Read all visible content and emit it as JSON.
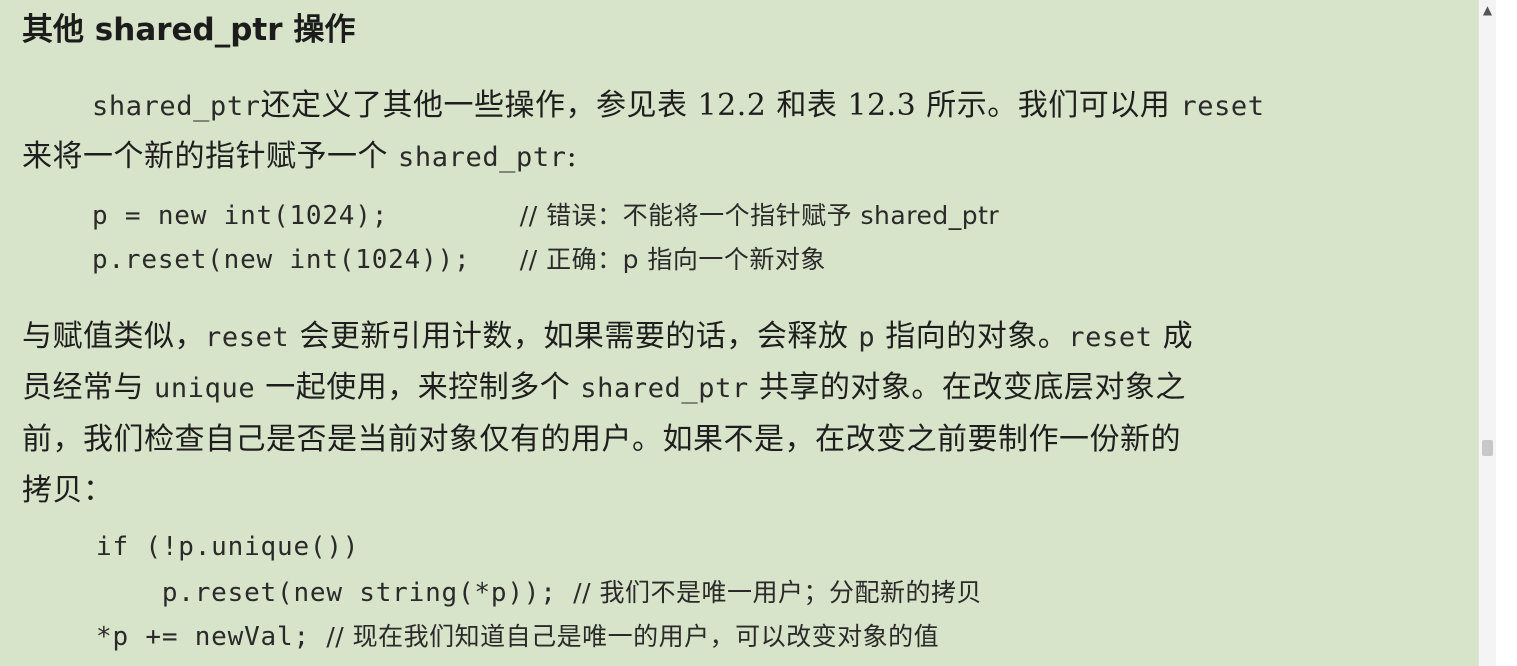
{
  "heading": "其他 shared_ptr 操作",
  "para1": {
    "line1": {
      "code_a": "shared_ptr",
      "text_a": "还定义了其他一些操作，参见表 12.2 和表 12.3 所示。我们可以用",
      "code_b": "reset"
    },
    "line2": {
      "text_a": "来将一个新的指针赋予一个",
      "code_a": "shared_ptr",
      "text_b": ":"
    }
  },
  "code1": [
    {
      "code": "p = new int(1024);        ",
      "comment": "// 错误：不能将一个指针赋予 shared_ptr"
    },
    {
      "code": "p.reset(new int(1024));   ",
      "comment": "// 正确：p 指向一个新对象"
    }
  ],
  "para2": {
    "line1": {
      "text_a": "与赋值类似，",
      "code_a": "reset",
      "text_b": "会更新引用计数，如果需要的话，会释放",
      "code_b": "p",
      "text_c": "指向的对象。",
      "code_c": "reset",
      "text_d": "成"
    },
    "line2": {
      "text_a": "员经常与",
      "code_a": "unique",
      "text_b": "一起使用，来控制多个",
      "code_b": "shared_ptr",
      "text_c": "共享的对象。在改变底层对象之"
    },
    "line3": "前，我们检查自己是否是当前对象仅有的用户。如果不是，在改变之前要制作一份新的",
    "line4": "拷贝："
  },
  "code2": [
    {
      "code": "if (!p.unique())",
      "comment": ""
    },
    {
      "code": "    p.reset(new string(*p)); ",
      "comment": "// 我们不是唯一用户；分配新的拷贝"
    },
    {
      "code": "*p += newVal; ",
      "comment": "// 现在我们知道自己是唯一的用户，可以改变对象的值"
    }
  ],
  "scrollbar": {
    "up_icon": "▲"
  },
  "colors": {
    "page_background": "#d7e4c9",
    "text": "#1e1e1e",
    "scrollbar_track": "#f4f4f4",
    "scrollbar_thumb": "#c8c8c8"
  }
}
